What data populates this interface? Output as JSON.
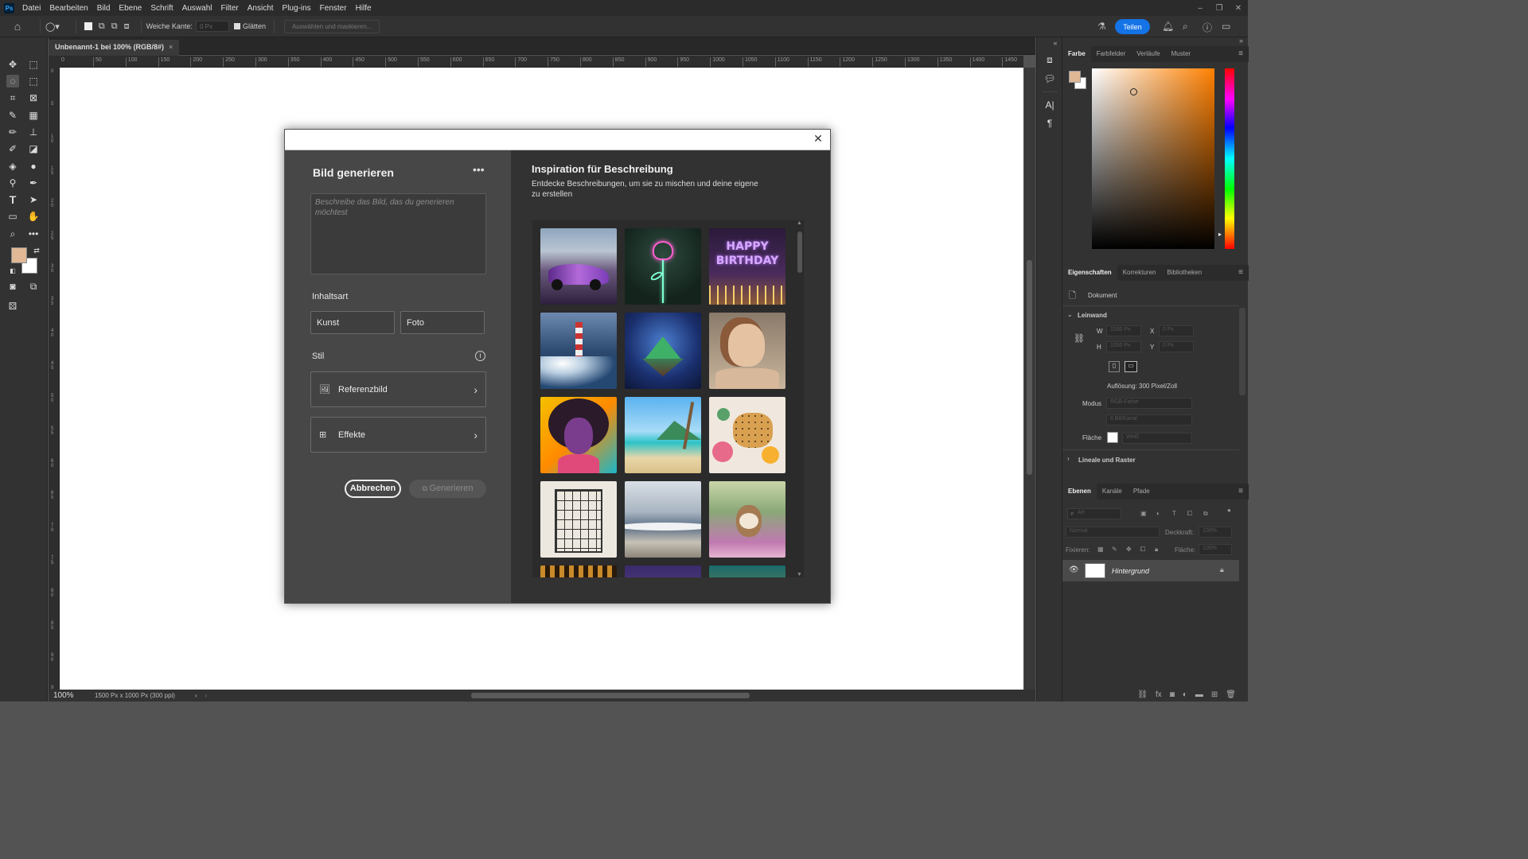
{
  "menubar": {
    "items": [
      "Datei",
      "Bearbeiten",
      "Bild",
      "Ebene",
      "Schrift",
      "Auswahl",
      "Filter",
      "Ansicht",
      "Plug-ins",
      "Fenster",
      "Hilfe"
    ]
  },
  "options": {
    "feather_label": "Weiche Kante:",
    "feather_value": "0 Px",
    "smooth_label": "Glätten",
    "select_mask": "Auswählen und maskieren...",
    "share": "Teilen"
  },
  "document": {
    "tab": "Unbenannt-1 bei 100% (RGB/8#)",
    "zoom": "100%",
    "info": "1500 Px x 1000 Px (300 ppi)",
    "ruler_ticks": [
      "50",
      "100",
      "150",
      "200",
      "250",
      "300",
      "350",
      "400",
      "450",
      "500",
      "550",
      "600",
      "650",
      "700",
      "750",
      "800",
      "850",
      "900",
      "950",
      "1000",
      "1050",
      "1100",
      "1150",
      "1200",
      "1250",
      "1300",
      "1350",
      "1400",
      "1450"
    ],
    "ruler_v": [
      "0",
      "5",
      "1 0",
      "1 5",
      "2 0",
      "2 5",
      "3 0",
      "3 5",
      "4 0",
      "4 5",
      "5 0",
      "5 5",
      "6 0",
      "6 5",
      "7 0",
      "7 5",
      "8 0",
      "8 5",
      "9 0",
      "9 5"
    ]
  },
  "dialog": {
    "title": "Bild generieren",
    "prompt_placeholder": "Beschreibe das Bild, das du generieren möchtest",
    "content_type_label": "Inhaltsart",
    "content_types": [
      "Kunst",
      "Foto"
    ],
    "style_label": "Stil",
    "reference_image": "Referenzbild",
    "effects": "Effekte",
    "cancel": "Abbrechen",
    "generate": "Generieren",
    "inspiration_title": "Inspiration für Beschreibung",
    "inspiration_desc": "Entdecke Beschreibungen, um sie zu mischen und deine eigene zu erstellen",
    "birthday_text": "HAPPY BIRTHDAY"
  },
  "panels": {
    "color_tabs": [
      "Farbe",
      "Farbfelder",
      "Verläufe",
      "Muster"
    ],
    "prop_tabs": [
      "Eigenschaften",
      "Korrekturen",
      "Bibliotheken"
    ],
    "doc_label": "Dokument",
    "canvas_section": "Leinwand",
    "w_label": "W",
    "w_value": "1500 Px",
    "h_label": "H",
    "h_value": "1000 Px",
    "x_label": "X",
    "x_value": "0 Px",
    "y_label": "Y",
    "y_value": "0 Px",
    "resolution": "Auflösung: 300 Pixel/Zoll",
    "mode_label": "Modus",
    "mode_value": "RGB-Farbe",
    "bit_value": "8 Bit/Kanal",
    "fill_label": "Fläche",
    "fill_value": "Weiß",
    "rulers_section": "Lineale und Raster",
    "layer_tabs": [
      "Ebenen",
      "Kanäle",
      "Pfade"
    ],
    "layer_filter": "Art",
    "blend_mode": "Normal",
    "opacity_label": "Deckkraft:",
    "opacity_value": "100%",
    "lock_label": "Fixieren:",
    "fill2_label": "Fläche:",
    "fill2_value": "100%",
    "layer_name": "Hintergrund"
  },
  "colors": {
    "foreground": "#e0b896",
    "background": "#ffffff",
    "accent": "#1473e6"
  }
}
